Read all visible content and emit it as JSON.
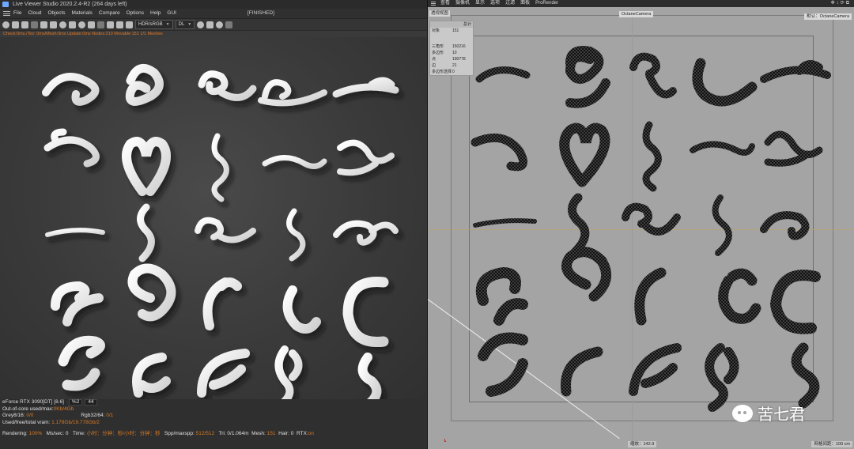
{
  "live_viewer": {
    "title": "Live Viewer Studio 2020.2.4-R2 (264 days left)",
    "menu": [
      "File",
      "Cloud",
      "Objects",
      "Materials",
      "Compare",
      "Options",
      "Help",
      "GUI"
    ],
    "render_status": "[FINISHED]",
    "toolbar": {
      "display_select": "HDR/sRGB",
      "mode_select": "DL"
    },
    "check_line": "Check:0ms./Tex: 0ms/Mesh:0ms Update:0ms Nodes:210 Movable:151 1/1 Meshes",
    "info": {
      "gpu": "eForce RTX 3090[DT] [8.6]",
      "gpu_pct": "%2",
      "gpu_temp": "44",
      "ooc_label": "Out-of-core used/max:",
      "ooc_value": "0Kb/4Gb",
      "grey_label": "Grey8/16:",
      "grey_value": "0/0",
      "rgb_label": "Rgb32/64:",
      "rgb_value": "0/1",
      "vram_label": "Used/free/total vram:",
      "vram_value": "1.178Gb/19.778Gb/2",
      "rendering_label": "Rendering:",
      "rendering_value": "100%",
      "mssec_label": "Ms/sec:",
      "mssec_value": "0",
      "time_label": "Time:",
      "time_value": "小时：分钟：秒/小时：分钟：秒",
      "spp_label": "Spp/maxspp:",
      "spp_value": "512/512",
      "tri_label": "Tri:",
      "tri_value": "0/1.064m",
      "mesh_label": "Mesh:",
      "mesh_value": "151",
      "hair_label": "Hair:",
      "hair_value": "0",
      "rtx_label": "RTX:",
      "rtx_value": "on"
    }
  },
  "c4d_viewport": {
    "menu": [
      "查看",
      "摄像机",
      "显示",
      "选项",
      "过滤",
      "面板",
      "ProRender"
    ],
    "view_label": "透视视图",
    "camera_tag": "OctaneCamera",
    "camera_tag_right": "默认：OctaneCamera",
    "stats": {
      "header": "总计",
      "rows": [
        {
          "k": "对象",
          "v": "151"
        },
        {
          "k": "三角形",
          "v": "150216"
        },
        {
          "k": "多边形",
          "v": "10"
        },
        {
          "k": "点",
          "v": "190778"
        },
        {
          "k": "边",
          "v": "21"
        },
        {
          "k": "多边形选择",
          "v": "0"
        }
      ]
    },
    "zoom_label": "缩放：142.9",
    "grid_label": "网格间距：100 cm",
    "watermark": "苦七君"
  },
  "colors": {
    "render_bg": "#3a3a3a",
    "viewport_bg": "#a4a4a4",
    "accent_orange": "#d87a24",
    "ornament": "#ececec",
    "wireframe": "#151515"
  }
}
